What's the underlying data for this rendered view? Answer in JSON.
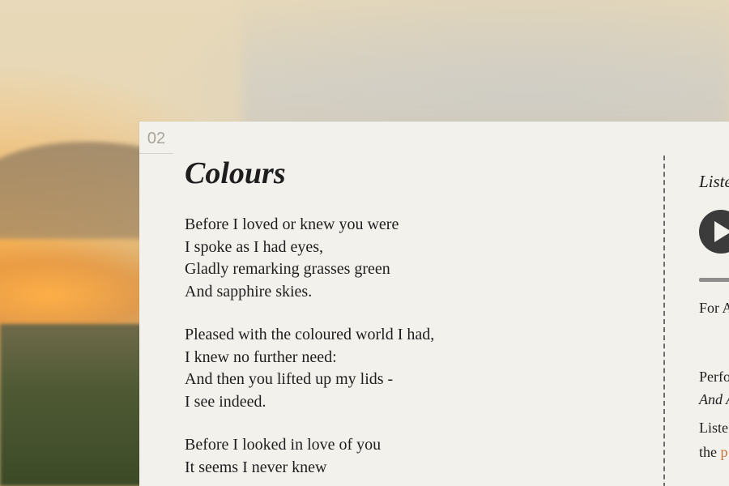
{
  "page": {
    "number": "02"
  },
  "poem": {
    "title": "Colours",
    "stanzas": [
      {
        "lines": [
          "Before I loved or knew you were",
          "I spoke as I had eyes,",
          "Gladly remarking grasses green",
          "And sapphire skies."
        ]
      },
      {
        "lines": [
          "Pleased with the coloured world I had,",
          "I knew no further need:",
          "And then you lifted up my lids -",
          "I see indeed."
        ]
      },
      {
        "lines": [
          "Before I looked in love of you",
          "It seems I never knew"
        ]
      }
    ]
  },
  "side": {
    "heading": "Liste",
    "player": {
      "play_icon": "play-icon",
      "progress": 0
    },
    "for_text": "For A",
    "performed_text": "Perfo",
    "performed_sub": "And A",
    "listen_text": "Liste",
    "the_text": "the",
    "link_text": "p"
  },
  "colors": {
    "card_background": "#f3f1ec",
    "text": "#1e1e1e",
    "page_number": "#a9a49b",
    "play_button": "#3b3b3b",
    "link": "#c1733a"
  }
}
